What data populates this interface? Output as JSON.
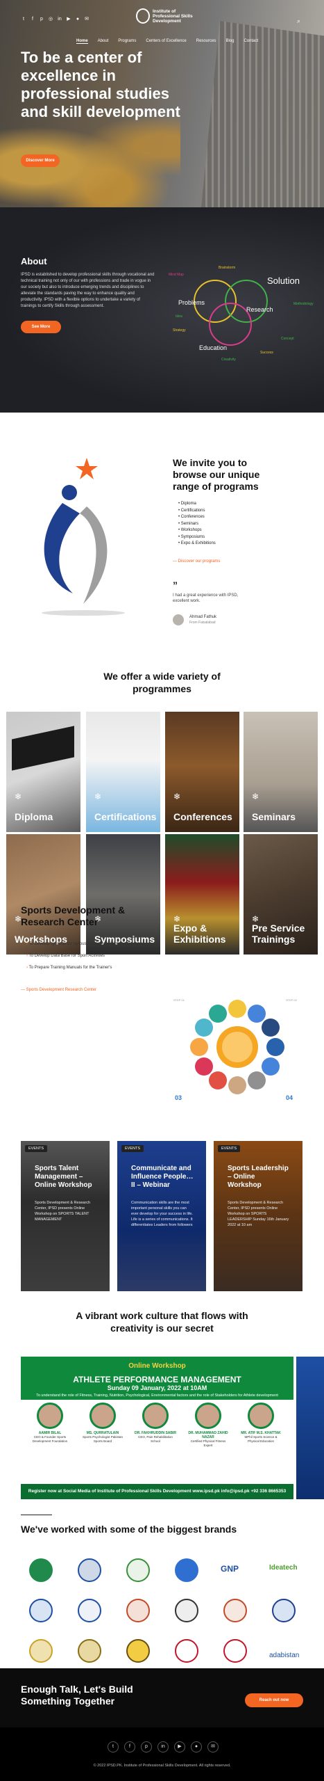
{
  "header": {
    "logo_line1": "Institute of",
    "logo_line2": "Professional Skills",
    "logo_line3": "Development",
    "nav": [
      "Home",
      "About",
      "Programs",
      "Centers of Excellence",
      "Resources",
      "Blog",
      "Contact"
    ],
    "social_icons": [
      "twitter-icon",
      "facebook-icon",
      "pinterest-icon",
      "instagram-icon",
      "linkedin-icon",
      "youtube-icon",
      "flickr-icon",
      "email-icon"
    ]
  },
  "hero": {
    "title": "To be a center of excellence in professional studies and skill development",
    "button": "Discover More"
  },
  "about": {
    "title": "About",
    "text": "IPSD is established to develop professional skills through vocational and technical training not only of our with professions and trade in vogue in our society but also to introduce emerging trends and disciplines to alleviate the standards paving the way to enhance quality and productivity. IPSD with a flexible options to undertake a variety of trainings to certify Skills through assessment.",
    "button": "See More",
    "venn_labels": [
      "Solution",
      "Problems",
      "Research",
      "Education",
      "Brainstorm",
      "Creativity",
      "Mind Map",
      "Strategy",
      "Idea",
      "Methodology",
      "Concept",
      "Success",
      "Knowledge",
      "Creating"
    ]
  },
  "programs": {
    "title": "We invite you to browse our unique range of programs",
    "items": [
      "Diploma",
      "Certifications",
      "Conferences",
      "Seminars",
      "Workshops",
      "Symposiums",
      "Expo & Exhibitions"
    ],
    "link": "Discover our programs",
    "quote": "I had a great experience with IPSD, excellent work.",
    "quote_author": "Ahmad Fathuk",
    "quote_role": "From Faisalabad"
  },
  "offer": {
    "title": "We offer a wide variety of programmes",
    "tiles": [
      "Diploma",
      "Certifications",
      "Conferences",
      "Seminars",
      "Workshops",
      "Symposiums",
      "Expo & Exhibitions",
      "Pre Service Trainings"
    ]
  },
  "sports": {
    "title": "Sports Development & Research Center",
    "items": [
      "To Develop syllabus for various certificate & Diploma Courses",
      "To Develop Data Base for Sport Activities",
      "To Prepare Training Manuals for the Trainer's"
    ],
    "link": "Sports Development Research Center",
    "wheel_numbers": [
      "03",
      "04"
    ],
    "wheel_labels": [
      "STEP 01",
      "STEP 02"
    ]
  },
  "events": [
    {
      "tag": "EVENTS",
      "title": "Sports Talent Management – Online Workshop",
      "text": "Sports Development & Research Center, IPSD presents Online Workshop on SPORTS TALENT MANAGEMENT"
    },
    {
      "tag": "EVENTS",
      "title": "Communicate and Influence People… II – Webinar",
      "text": "Communication skills are the most important personal skills you can ever develop for your success in life. Life is a series of communications. It differentiates Leaders from followers"
    },
    {
      "tag": "EVENTS",
      "title": "Sports Leadership – Online Workshop",
      "text": "Sports Development & Research Center, IPSD presents Online Workshop on SPORTS LEADERSHIP Sunday 16th January 2022 at 10 am"
    }
  ],
  "vibrant_title": "A vibrant work culture that flows with creativity is our secret",
  "banner": {
    "tag": "Online Workshop",
    "headline": "ATHLETE PERFORMANCE MANAGEMENT",
    "date": "Sunday 09 January, 2022 at 10AM",
    "subtitle": "To understand the role of Fitness, Training, Nutrition, Psychological, Environmental factors and the role of Stakeholders for Athlete development",
    "speakers": [
      {
        "name": "AAMIR BILAL",
        "role": "CEO & Founder Sports Development Foundation"
      },
      {
        "name": "MS. QURRATULAIN",
        "role": "Sports Psychologist Pakistan Sports Board"
      },
      {
        "name": "DR. FAKHRUDDIN SABIR",
        "role": "CEO, Pain Rehabilitation School"
      },
      {
        "name": "DR. MUHAMMAD ZAHID NAZAR",
        "role": "Certified Physical Fitness Expert"
      },
      {
        "name": "MR. ATIF M.S. KHATTAK",
        "role": "MPhil Sports Science & Physical Education"
      }
    ],
    "footer": "Register now at Social Media of Institute of Professional Skills Development   www.ipsd.pk   info@ipsd.pk   +92 336 8665353"
  },
  "brands_title": "We've worked with some of the biggest brands",
  "brands": [
    "GNP",
    "Ideatech",
    "adabistan"
  ],
  "cta": {
    "title": "Enough Talk, Let's Build Something Together",
    "button": "Reach out now"
  },
  "footer": {
    "copyright": "© 2022 IPSD.PK. Institute of Professional Skills Development. All rights reserved."
  }
}
